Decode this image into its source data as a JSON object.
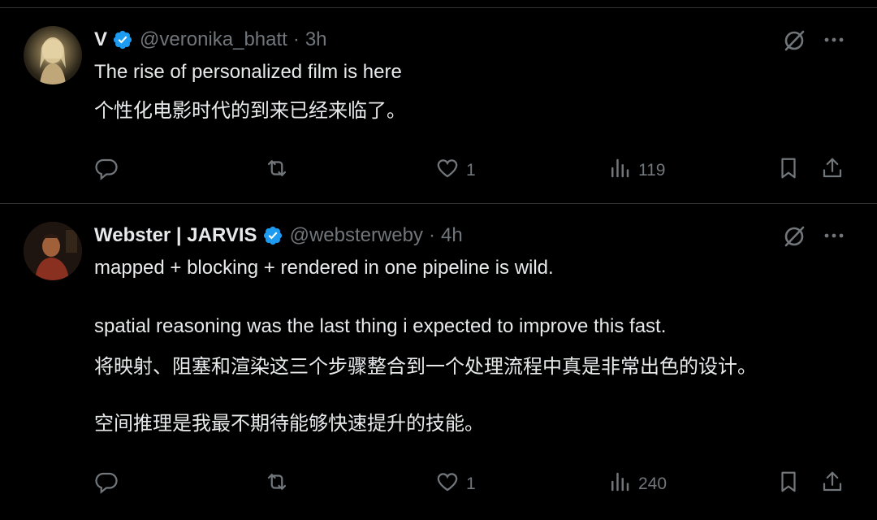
{
  "posts": [
    {
      "name": "V",
      "handle": "@veronika_bhatt",
      "separator": "·",
      "time": "3h",
      "text": [
        "The rise of personalized film is here",
        "个性化电影时代的到来已经来临了。"
      ],
      "replies": "",
      "retweets": "",
      "likes": "1",
      "views": "119"
    },
    {
      "name": "Webster | JARVIS",
      "handle": "@websterweby",
      "separator": "·",
      "time": "4h",
      "text": [
        "mapped + blocking + rendered in one pipeline is wild.",
        "spatial reasoning was the last thing i expected to improve this fast.",
        "将映射、阻塞和渲染这三个步骤整合到一个处理流程中真是非常出色的设计。",
        "空间推理是我最不期待能够快速提升的技能。"
      ],
      "replies": "",
      "retweets": "",
      "likes": "1",
      "views": "240"
    }
  ],
  "colors": {
    "background": "#000000",
    "text": "#e7e9ea",
    "muted": "#71767b",
    "verified": "#1d9bf0",
    "divider": "#2f3336"
  },
  "icons": [
    "grok-icon",
    "more-icon",
    "reply-icon",
    "retweet-icon",
    "like-icon",
    "views-icon",
    "bookmark-icon",
    "share-icon",
    "verified-badge-icon"
  ]
}
